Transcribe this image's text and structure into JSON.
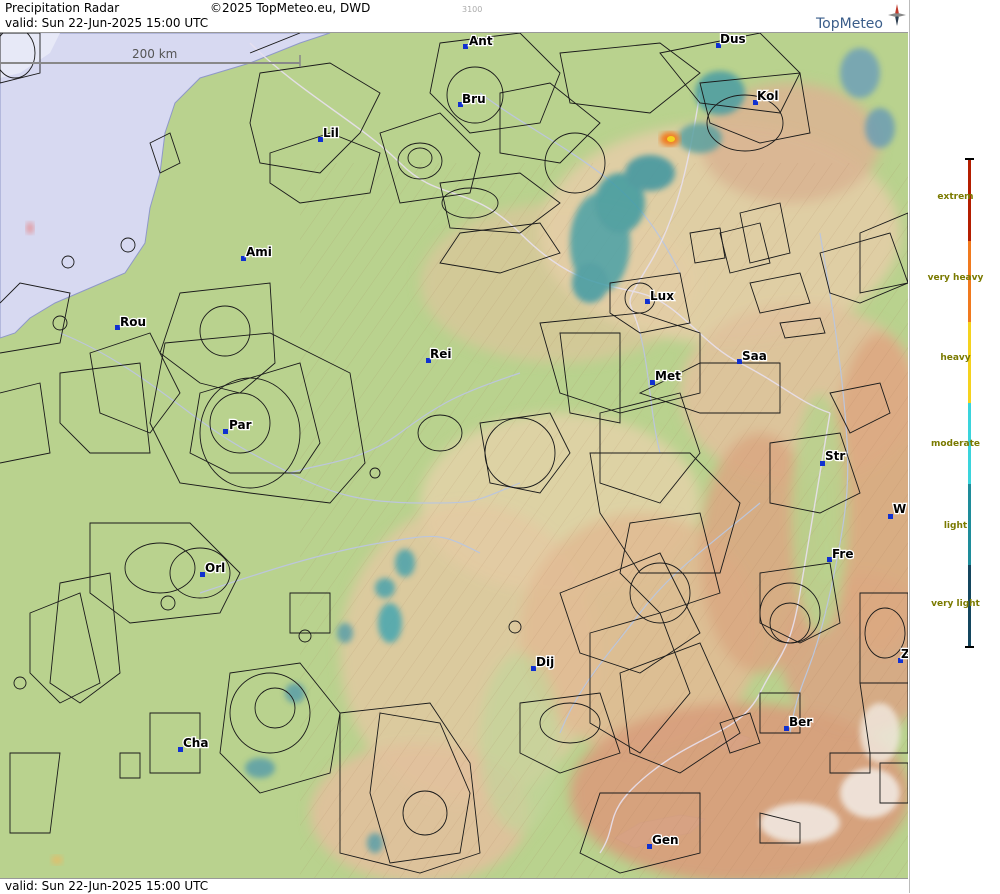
{
  "header": {
    "title": "Precipitation Radar",
    "copyright": "©2025 TopMeteo.eu, DWD",
    "valid": "valid:  Sun  22-Jun-2025 15:00 UTC",
    "small_code": "3100",
    "brand": "TopMeteo"
  },
  "footer": {
    "valid": "valid:  Sun  22-Jun-2025 15:00 UTC"
  },
  "scale_bar": {
    "label": "200 km"
  },
  "cities": [
    {
      "label": "Ant"
    },
    {
      "label": "Dus"
    },
    {
      "label": "Bru"
    },
    {
      "label": "Kol"
    },
    {
      "label": "Lil"
    },
    {
      "label": "Ami"
    },
    {
      "label": "Rou"
    },
    {
      "label": "Rei"
    },
    {
      "label": "Lux"
    },
    {
      "label": "Saa"
    },
    {
      "label": "Met"
    },
    {
      "label": "Par"
    },
    {
      "label": "Str"
    },
    {
      "label": "W"
    },
    {
      "label": "Fre"
    },
    {
      "label": "Orl"
    },
    {
      "label": "Dij"
    },
    {
      "label": "Ber"
    },
    {
      "label": "Cha"
    },
    {
      "label": "Gen"
    },
    {
      "label": "Z"
    }
  ],
  "legend": {
    "items": [
      {
        "label": "extrem",
        "color": "#b41e00"
      },
      {
        "label": "very heavy",
        "color": "#f07a1e"
      },
      {
        "label": "heavy",
        "color": "#f5d21e"
      },
      {
        "label": "moderate",
        "color": "#3ad4dc"
      },
      {
        "label": "light",
        "color": "#1e8c9a"
      },
      {
        "label": "very light",
        "color": "#14465e"
      }
    ]
  },
  "colors": {
    "sea": "#d6d8f0",
    "lowland": "#b6d08c",
    "upland": "#e6cfa6",
    "mountain": "#d9a784",
    "rain": "#3a9aa8"
  }
}
